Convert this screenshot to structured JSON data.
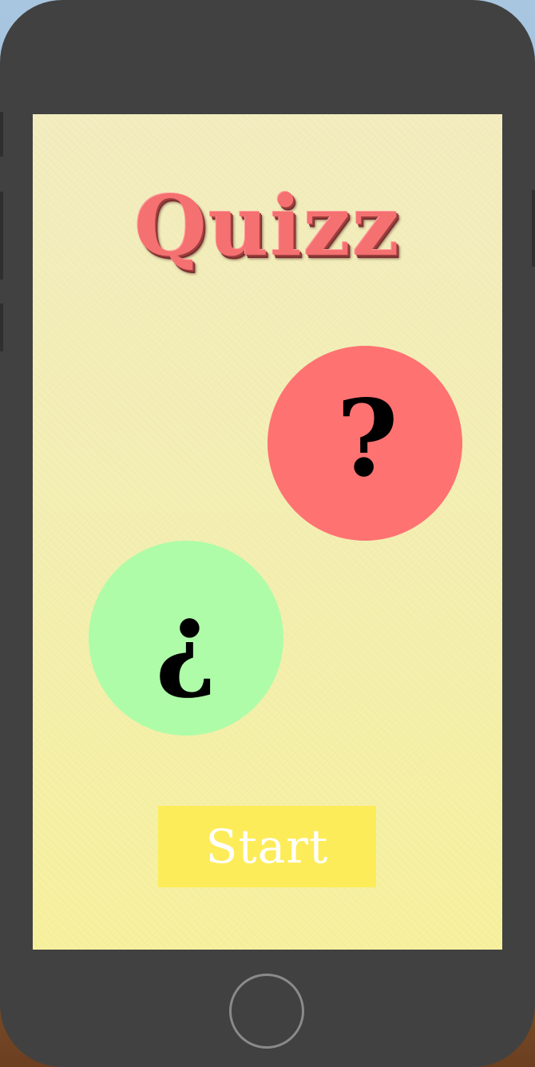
{
  "app": {
    "title": "Quizz"
  },
  "bubbles": {
    "question": {
      "glyph": "?",
      "color": "#fe7272"
    },
    "inverted_question": {
      "glyph": "¿",
      "color": "#aefca8"
    }
  },
  "start_button": {
    "label": "Start",
    "color": "#fdec59"
  },
  "colors": {
    "device_frame": "#414141",
    "screen_background": "#f3eeb0",
    "title": "#f57070"
  },
  "device": {
    "home_button_icon": "home-button-ring"
  }
}
